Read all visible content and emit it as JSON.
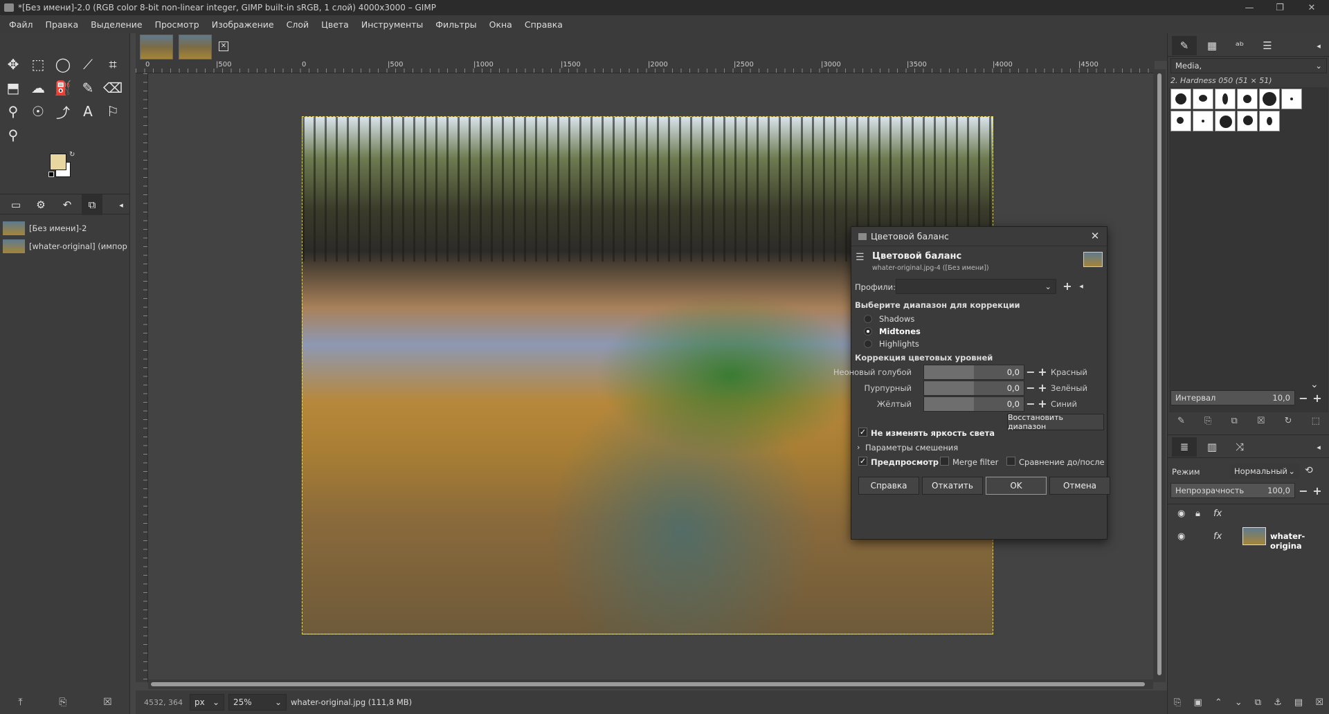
{
  "window": {
    "title": "*[Без имени]-2.0 (RGB color 8-bit non-linear integer, GIMP built-in sRGB, 1 слой) 4000x3000 – GIMP"
  },
  "menu": [
    "Файл",
    "Правка",
    "Выделение",
    "Просмотр",
    "Изображение",
    "Слой",
    "Цвета",
    "Инструменты",
    "Фильтры",
    "Окна",
    "Справка"
  ],
  "images_panel": {
    "items": [
      "[Без имени]-2",
      "[whater-original] (импорти"
    ]
  },
  "ruler": {
    "top_labels": [
      "0",
      "|500",
      "0",
      "|500",
      "|1000",
      "|1500",
      "|2000",
      "|2500",
      "|3000",
      "|3500",
      "|4000",
      "|4500"
    ],
    "left_labels": [
      "0",
      "5\n0\n0",
      "1\n0\n0\n0",
      "1\n5\n0\n0",
      "2\n0\n0\n0",
      "2\n5\n0\n0",
      "3\n0\n0\n0"
    ]
  },
  "statusbar": {
    "coords": "4532, 364",
    "unit": "px",
    "zoom": "25%",
    "file_info": "whater-original.jpg (111,8 MB)"
  },
  "brushes": {
    "category": "Media,",
    "selected_brush": "2. Hardness 050 (51 × 51)",
    "spacing_label": "Интервал",
    "spacing_value": "10,0"
  },
  "layers": {
    "mode_label": "Режим",
    "mode_value": "Нормальный",
    "opacity_label": "Непрозрачность",
    "opacity_value": "100,0",
    "layer_name": "whater-origina"
  },
  "dialog": {
    "title": "Цветовой баланс",
    "heading": "Цветовой баланс",
    "subheading": "whater-original.jpg-4 ([Без имени])",
    "profiles_label": "Профили:",
    "range_title": "Выберите диапазон для коррекции",
    "ranges": [
      "Shadows",
      "Midtones",
      "Highlights"
    ],
    "selected_range": "Midtones",
    "levels_title": "Коррекция цветовых уровней",
    "sliders": [
      {
        "left": "Неоновый голубой",
        "value": "0,0",
        "right": "Красный"
      },
      {
        "left": "Пурпурный",
        "value": "0,0",
        "right": "Зелёный"
      },
      {
        "left": "Жёлтый",
        "value": "0,0",
        "right": "Синий"
      }
    ],
    "reset_range": "Восстановить диапазон",
    "preserve_luminosity": "Не изменять яркость света",
    "blending": "Параметры смешения",
    "preview": "Предпросмотр",
    "merge_filter": "Merge filter",
    "split_view": "Сравнение до/после",
    "buttons": {
      "help": "Справка",
      "reset": "Откатить",
      "ok": "OK",
      "cancel": "Отмена"
    }
  }
}
